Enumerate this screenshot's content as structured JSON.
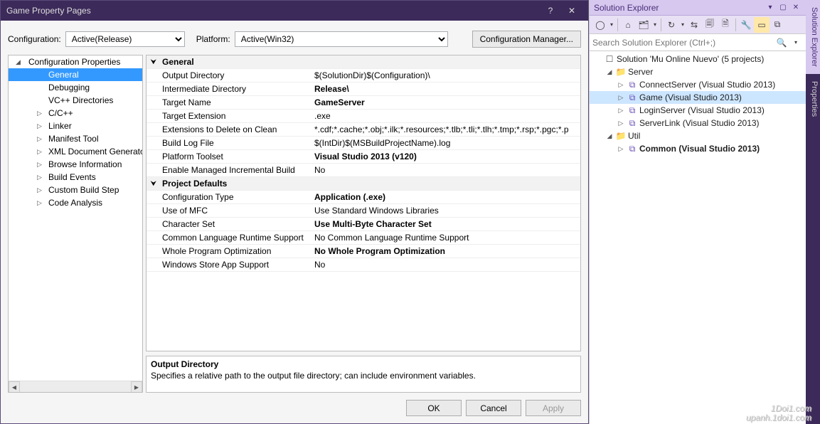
{
  "dialog": {
    "title": "Game Property Pages",
    "config_label": "Configuration:",
    "config_value": "Active(Release)",
    "platform_label": "Platform:",
    "platform_value": "Active(Win32)",
    "manager_btn": "Configuration Manager...",
    "nav": {
      "root": "Configuration Properties",
      "items": [
        "General",
        "Debugging",
        "VC++ Directories",
        "C/C++",
        "Linker",
        "Manifest Tool",
        "XML Document Generator",
        "Browse Information",
        "Build Events",
        "Custom Build Step",
        "Code Analysis"
      ]
    },
    "grid": {
      "cat1": "General",
      "rows1": [
        {
          "l": "Output Directory",
          "v": "$(SolutionDir)$(Configuration)\\",
          "b": false
        },
        {
          "l": "Intermediate Directory",
          "v": "Release\\",
          "b": true
        },
        {
          "l": "Target Name",
          "v": "GameServer",
          "b": true
        },
        {
          "l": "Target Extension",
          "v": ".exe",
          "b": false
        },
        {
          "l": "Extensions to Delete on Clean",
          "v": "*.cdf;*.cache;*.obj;*.ilk;*.resources;*.tlb;*.tli;*.tlh;*.tmp;*.rsp;*.pgc;*.p",
          "b": false
        },
        {
          "l": "Build Log File",
          "v": "$(IntDir)$(MSBuildProjectName).log",
          "b": false
        },
        {
          "l": "Platform Toolset",
          "v": "Visual Studio 2013 (v120)",
          "b": true
        },
        {
          "l": "Enable Managed Incremental Build",
          "v": "No",
          "b": false
        }
      ],
      "cat2": "Project Defaults",
      "rows2": [
        {
          "l": "Configuration Type",
          "v": "Application (.exe)",
          "b": true
        },
        {
          "l": "Use of MFC",
          "v": "Use Standard Windows Libraries",
          "b": false
        },
        {
          "l": "Character Set",
          "v": "Use Multi-Byte Character Set",
          "b": true
        },
        {
          "l": "Common Language Runtime Support",
          "v": "No Common Language Runtime Support",
          "b": false
        },
        {
          "l": "Whole Program Optimization",
          "v": "No Whole Program Optimization",
          "b": true
        },
        {
          "l": "Windows Store App Support",
          "v": "No",
          "b": false
        }
      ]
    },
    "desc": {
      "h": "Output Directory",
      "t": "Specifies a relative path to the output file directory; can include environment variables."
    },
    "buttons": {
      "ok": "OK",
      "cancel": "Cancel",
      "apply": "Apply"
    }
  },
  "se": {
    "title": "Solution Explorer",
    "search_placeholder": "Search Solution Explorer (Ctrl+;)",
    "solution": "Solution 'Mu Online Nuevo' (5 projects)",
    "folders": [
      {
        "name": "Server",
        "children": [
          {
            "name": "ConnectServer (Visual Studio 2013)",
            "bold": false
          },
          {
            "name": "Game (Visual Studio 2013)",
            "bold": false,
            "sel": true
          },
          {
            "name": "LoginServer (Visual Studio 2013)",
            "bold": false
          },
          {
            "name": "ServerLink (Visual Studio 2013)",
            "bold": false
          }
        ]
      },
      {
        "name": "Util",
        "children": [
          {
            "name": "Common (Visual Studio 2013)",
            "bold": true
          }
        ]
      }
    ]
  },
  "tabs": {
    "se": "Solution Explorer",
    "props": "Properties"
  },
  "watermark": {
    "l1": "1Doi1.com",
    "l2": "upanh.1doi1.com"
  }
}
